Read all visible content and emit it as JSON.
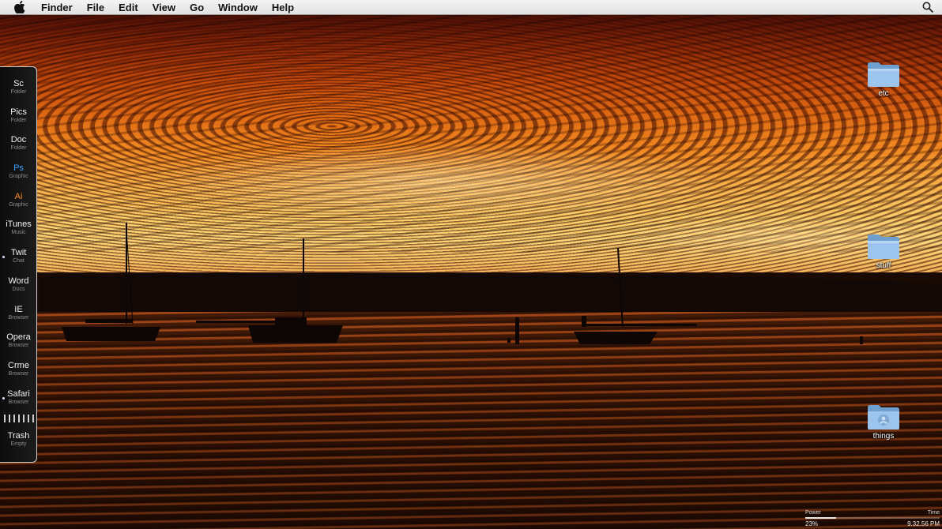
{
  "menubar": {
    "apple_icon": "apple-icon",
    "items": [
      "Finder",
      "File",
      "Edit",
      "View",
      "Go",
      "Window",
      "Help"
    ],
    "search_icon": "spotlight-search-icon"
  },
  "dock": {
    "items": [
      {
        "label": "Sc",
        "sub": "Folder",
        "color": "#f2f2f2",
        "running": false
      },
      {
        "label": "Pics",
        "sub": "Folder",
        "color": "#f2f2f2",
        "running": false
      },
      {
        "label": "Doc",
        "sub": "Folder",
        "color": "#f2f2f2",
        "running": false
      },
      {
        "label": "Ps",
        "sub": "Graphic",
        "color": "#3aa0ff",
        "running": false
      },
      {
        "label": "Ai",
        "sub": "Graphic",
        "color": "#ff8a1e",
        "running": false
      },
      {
        "label": "iTunes",
        "sub": "Music",
        "color": "#f2f2f2",
        "running": false
      },
      {
        "label": "Twit",
        "sub": "Chat",
        "color": "#f2f2f2",
        "running": true
      },
      {
        "label": "Word",
        "sub": "Docs",
        "color": "#f2f2f2",
        "running": false
      },
      {
        "label": "IE",
        "sub": "Browser",
        "color": "#f2f2f2",
        "running": false
      },
      {
        "label": "Opera",
        "sub": "Browser",
        "color": "#f2f2f2",
        "running": false
      },
      {
        "label": "Crme",
        "sub": "Browser",
        "color": "#f2f2f2",
        "running": false
      },
      {
        "label": "Safari",
        "sub": "Browser",
        "color": "#f2f2f2",
        "running": true
      },
      {
        "label": "Trash",
        "sub": "Empty",
        "color": "#f2f2f2",
        "running": false
      }
    ]
  },
  "desktop_icons": [
    {
      "label": "etc",
      "icon": "folder-icon"
    },
    {
      "label": "stuff",
      "icon": "folder-icon"
    },
    {
      "label": "things",
      "icon": "shared-folder-icon"
    }
  ],
  "status": {
    "power_label": "Power",
    "power_value": "23%",
    "power_fraction": 0.23,
    "time_label": "Time",
    "time_value": "9.32.56 PM"
  }
}
